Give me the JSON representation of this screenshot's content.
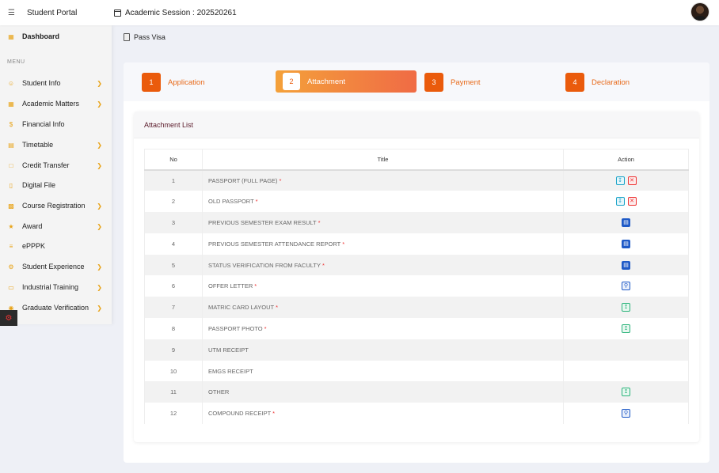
{
  "header": {
    "brand": "Student Portal",
    "session": "Academic Session : 202520261"
  },
  "sidebar": {
    "dashboard": "Dashboard",
    "menu_label": "MENU",
    "items": [
      {
        "label": "Student Info",
        "icon": "person-icon",
        "has_chevron": true
      },
      {
        "label": "Academic Matters",
        "icon": "grid-icon",
        "has_chevron": true
      },
      {
        "label": "Financial Info",
        "icon": "dollar-icon",
        "has_chevron": false
      },
      {
        "label": "Timetable",
        "icon": "calendar-icon",
        "has_chevron": true
      },
      {
        "label": "Credit Transfer",
        "icon": "document-icon",
        "has_chevron": true
      },
      {
        "label": "Digital File",
        "icon": "file-icon",
        "has_chevron": false
      },
      {
        "label": "Course Registration",
        "icon": "clipboard-icon",
        "has_chevron": true
      },
      {
        "label": "Award",
        "icon": "award-icon",
        "has_chevron": true
      },
      {
        "label": "ePPPK",
        "icon": "list-icon",
        "has_chevron": false
      },
      {
        "label": "Student Experience",
        "icon": "gear-icon",
        "has_chevron": true
      },
      {
        "label": "Industrial Training",
        "icon": "monitor-icon",
        "has_chevron": true
      },
      {
        "label": "Graduate Verification",
        "icon": "globe-icon",
        "has_chevron": true
      }
    ]
  },
  "breadcrumb": {
    "label": "Pass Visa"
  },
  "stepper": {
    "steps": [
      {
        "num": "1",
        "label": "Application",
        "active": false
      },
      {
        "num": "2",
        "label": "Attachment",
        "active": true
      },
      {
        "num": "3",
        "label": "Payment",
        "active": false
      },
      {
        "num": "4",
        "label": "Declaration",
        "active": false
      }
    ]
  },
  "attachment": {
    "title": "Attachment List",
    "columns": {
      "no": "No",
      "title": "Title",
      "action": "Action"
    },
    "rows": [
      {
        "no": "1",
        "title": "PASSPORT (FULL PAGE)",
        "required": true,
        "actions": [
          "download",
          "delete"
        ]
      },
      {
        "no": "2",
        "title": "OLD PASSPORT",
        "required": true,
        "actions": [
          "download",
          "delete"
        ]
      },
      {
        "no": "3",
        "title": "PREVIOUS SEMESTER EXAM RESULT",
        "required": true,
        "actions": [
          "file"
        ]
      },
      {
        "no": "4",
        "title": "PREVIOUS SEMESTER ATTENDANCE REPORT",
        "required": true,
        "actions": [
          "file"
        ]
      },
      {
        "no": "5",
        "title": "STATUS VERIFICATION FROM FACULTY",
        "required": true,
        "actions": [
          "file"
        ]
      },
      {
        "no": "6",
        "title": "OFFER LETTER",
        "required": true,
        "actions": [
          "view"
        ]
      },
      {
        "no": "7",
        "title": "MATRIC CARD LAYOUT",
        "required": true,
        "actions": [
          "upload"
        ]
      },
      {
        "no": "8",
        "title": "PASSPORT PHOTO",
        "required": true,
        "actions": [
          "upload"
        ]
      },
      {
        "no": "9",
        "title": "UTM RECEIPT",
        "required": false,
        "actions": []
      },
      {
        "no": "10",
        "title": "EMGS RECEIPT",
        "required": false,
        "actions": []
      },
      {
        "no": "11",
        "title": "OTHER",
        "required": false,
        "actions": [
          "upload"
        ]
      },
      {
        "no": "12",
        "title": "COMPOUND RECEIPT",
        "required": true,
        "actions": [
          "view"
        ]
      }
    ]
  },
  "colors": {
    "accent": "#ea5b0c",
    "sidebar_icon": "#e8a317",
    "required": "#e33333"
  }
}
